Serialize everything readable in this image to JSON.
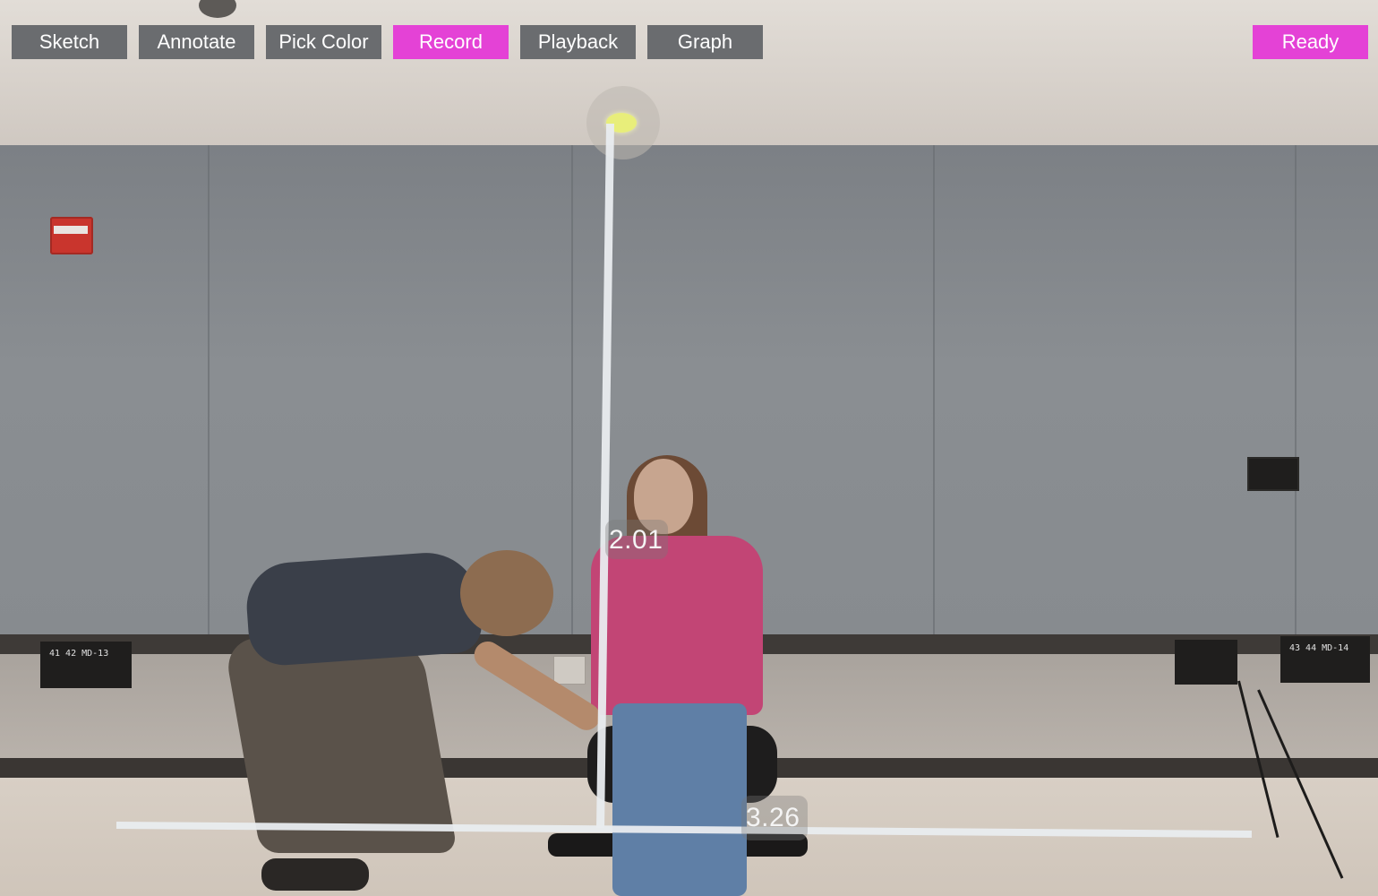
{
  "toolbar": {
    "buttons": [
      {
        "label": "Sketch",
        "active": false
      },
      {
        "label": "Annotate",
        "active": false
      },
      {
        "label": "Pick Color",
        "active": false
      },
      {
        "label": "Record",
        "active": true
      },
      {
        "label": "Playback",
        "active": false
      },
      {
        "label": "Graph",
        "active": false
      }
    ],
    "status_label": "Ready"
  },
  "colors": {
    "button_gray": "#6a6c6f",
    "accent_pink": "#e442d6",
    "measure_line": "#e9ecef",
    "tracked_ball": "#e8ee7a"
  },
  "measurements": {
    "vertical": "2.01",
    "horizontal": "3.26"
  },
  "scene": {
    "left_plate_text": "41  42  MD-13",
    "right_plate_text": "43  44  MD-14"
  }
}
